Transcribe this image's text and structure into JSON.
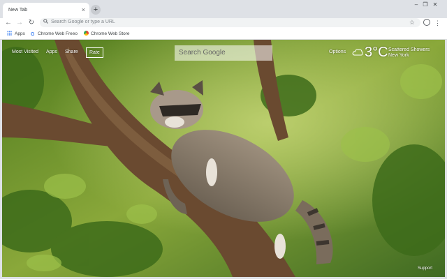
{
  "browser": {
    "tab_title": "New Tab",
    "tab_close": "×",
    "new_tab": "+",
    "window_controls": {
      "minimize": "–",
      "maximize": "❐",
      "close": "✕"
    },
    "nav": {
      "back": "←",
      "forward": "→",
      "reload": "↻"
    },
    "omnibox_placeholder": "Search Google or type a URL",
    "bookmark_star": "☆",
    "menu": "⋮",
    "bookmarks": [
      {
        "label": "Apps",
        "icon": "apps-grid-icon"
      },
      {
        "label": "Chrome Web Freeo",
        "icon": "google-icon"
      },
      {
        "label": "Chrome Web Store",
        "icon": "chrome-web-store-icon"
      }
    ]
  },
  "ntp": {
    "links": {
      "most_visited": "Most Visited",
      "apps": "Apps",
      "share": "Share",
      "rate": "Rate"
    },
    "search_placeholder": "Search Google",
    "options": "Options",
    "weather": {
      "icon": "cloud-icon",
      "temperature": "3°C",
      "condition": "Scattered Showers",
      "city": "New York"
    },
    "support": "Support"
  },
  "colors": {
    "chrome_frame": "#dee1e6",
    "omnibox": "#f1f3f4",
    "foliage": "#6f9a2a",
    "branch": "#6a4a30",
    "raccoon": "#8b7d6b"
  }
}
